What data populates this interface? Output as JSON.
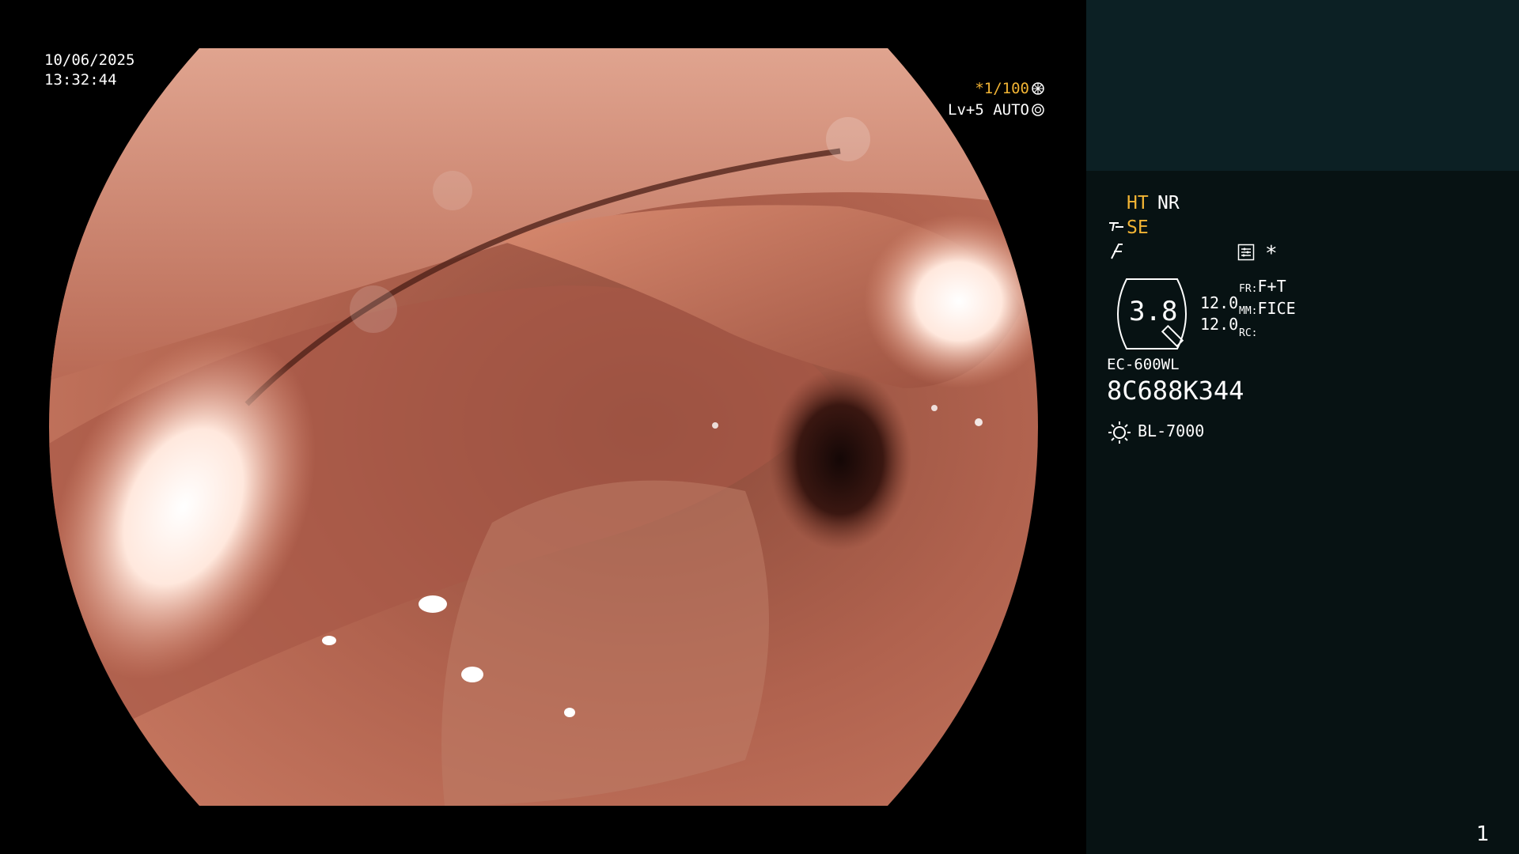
{
  "overlay": {
    "date": "10/06/2025",
    "time": "13:32:44",
    "shutter": "*1/100",
    "shutter_icon": "aperture-icon",
    "level": "Lv+5 AUTO",
    "level_icon": "iris-icon"
  },
  "panel": {
    "ht": "HT",
    "nr": "NR",
    "se": "SE",
    "se_icon": "structure-enhancement-icon",
    "filter_icon": "color-mode-icon",
    "memo_icon": "settings-list-icon",
    "star": "*",
    "zoom_value": "3.8",
    "ch_values": [
      "12.0",
      "12.0"
    ],
    "fr_label": "FR:",
    "fr_value": "F+T",
    "mm_label": "MM:",
    "mm_value": "FICE",
    "rc_label": "RC:",
    "rc_value": "",
    "scope_model": "EC-600WL",
    "serial": "8C688K344",
    "light_icon": "light-source-icon",
    "light_source": "BL-7000"
  },
  "page_number": "1",
  "colors": {
    "accent_orange": "#f2b434",
    "panel_top": "#0c2024",
    "panel_bottom": "#071213"
  }
}
